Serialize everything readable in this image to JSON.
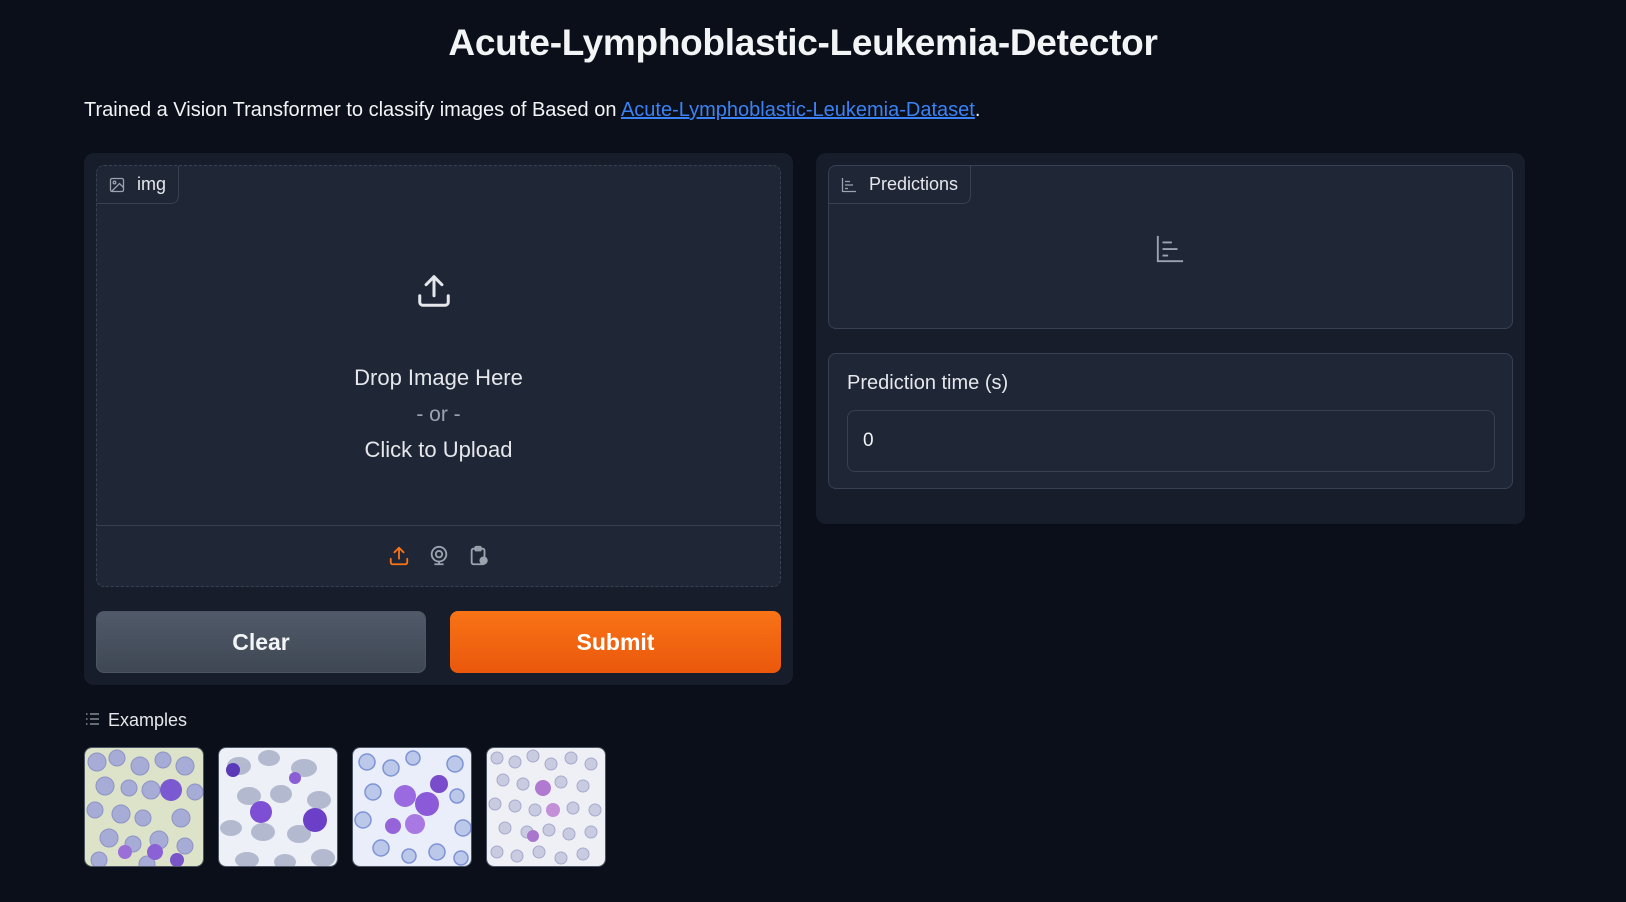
{
  "page": {
    "title": "Acute-Lymphoblastic-Leukemia-Detector",
    "description_prefix": "Trained a Vision Transformer to classify images of Based on ",
    "dataset_link": "Acute-Lymphoblastic-Leukemia-Dataset",
    "description_suffix": "."
  },
  "image_input": {
    "label": "img",
    "icon": "image-icon",
    "drop_text": "Drop Image Here",
    "or_text": "- or -",
    "click_text": "Click to Upload",
    "sources": [
      "upload-icon",
      "webcam-icon",
      "clipboard-icon"
    ]
  },
  "actions": {
    "clear_label": "Clear",
    "submit_label": "Submit"
  },
  "predictions": {
    "label": "Predictions",
    "icon": "bar-chart-icon"
  },
  "prediction_time": {
    "label": "Prediction time (s)",
    "value": "0"
  },
  "examples": {
    "label": "Examples",
    "icon": "list-icon",
    "count": 4
  },
  "colors": {
    "background": "#0b0f19",
    "panel": "#171d2b",
    "block": "#1f2636",
    "accent": "#f97316",
    "link": "#3b82f6"
  }
}
